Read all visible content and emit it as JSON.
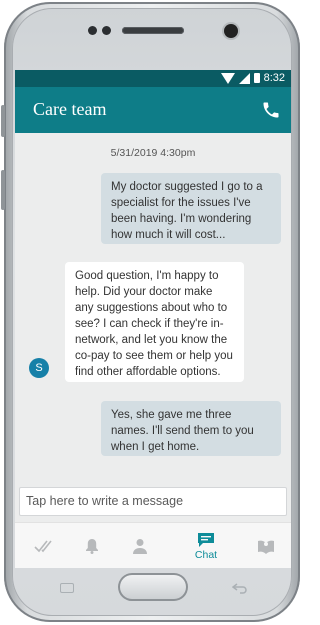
{
  "status_bar": {
    "time": "8:32"
  },
  "app_bar": {
    "title": "Care team"
  },
  "conversation": {
    "timestamp": "5/31/2019 4:30pm",
    "messages": [
      {
        "direction": "outgoing",
        "text": "My doctor suggested I go to a specialist for the issues I've been having. I'm wondering how much it will cost..."
      },
      {
        "direction": "incoming",
        "text": "Good question, I'm happy to help. Did your doctor make any suggestions about who to see? I can check if they're in-network, and let you know the co-pay to see them or help you find other affordable options.",
        "avatar_initial": "S"
      },
      {
        "direction": "outgoing",
        "text": "Yes, she gave me three names. I'll send them to you when I get home."
      }
    ]
  },
  "compose": {
    "placeholder": "Tap here to write a message"
  },
  "tabs": [
    {
      "icon": "double-check-icon",
      "label": ""
    },
    {
      "icon": "bell-icon",
      "label": ""
    },
    {
      "icon": "person-icon",
      "label": ""
    },
    {
      "icon": "chat-icon",
      "label": "Chat",
      "active": true
    },
    {
      "icon": "book-icon",
      "label": ""
    }
  ],
  "colors": {
    "accent": "#0e7d88",
    "status_bar": "#0a5b63",
    "active_tab": "#0e8c99",
    "avatar": "#1680a8"
  }
}
